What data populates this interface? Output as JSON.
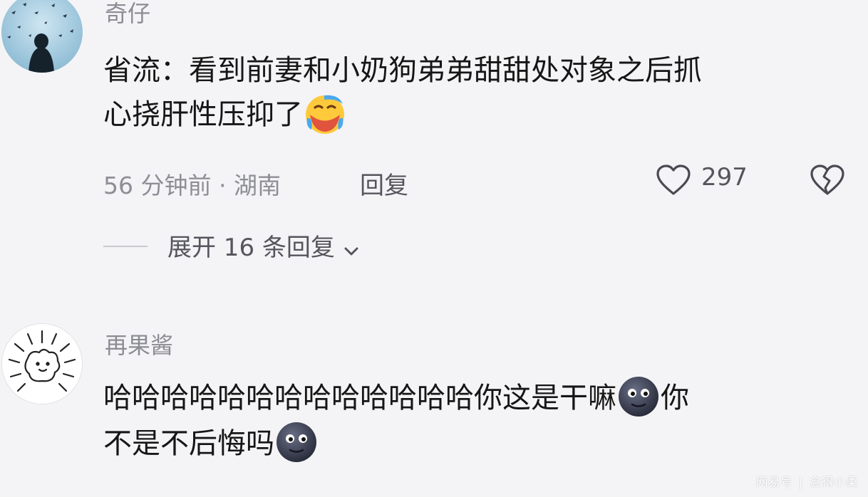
{
  "comments": [
    {
      "username": "奇仔",
      "text_line1": "省流：看到前妻和小奶狗弟弟甜甜处对象之后抓",
      "text_line2": "心挠肝性压抑了",
      "emoji": "crying-laughing-emoji",
      "meta": "56 分钟前 · 湖南",
      "reply_label": "回复",
      "like_count": "297",
      "expand_label": "展开 16 条回复"
    },
    {
      "username": "再果酱",
      "text_line1": "哈哈哈哈哈哈哈哈哈哈哈哈哈你这是干嘛",
      "text_line1_tail": "你",
      "text_line2": "不是不后悔吗",
      "emoji": "dark-smiley-emoji"
    }
  ],
  "watermark": {
    "brand": "网易号",
    "separator": "|",
    "author": "念得小柔"
  },
  "colors": {
    "background": "#f4f4f6",
    "meta_gray": "#8e8e96",
    "text": "#161616"
  }
}
